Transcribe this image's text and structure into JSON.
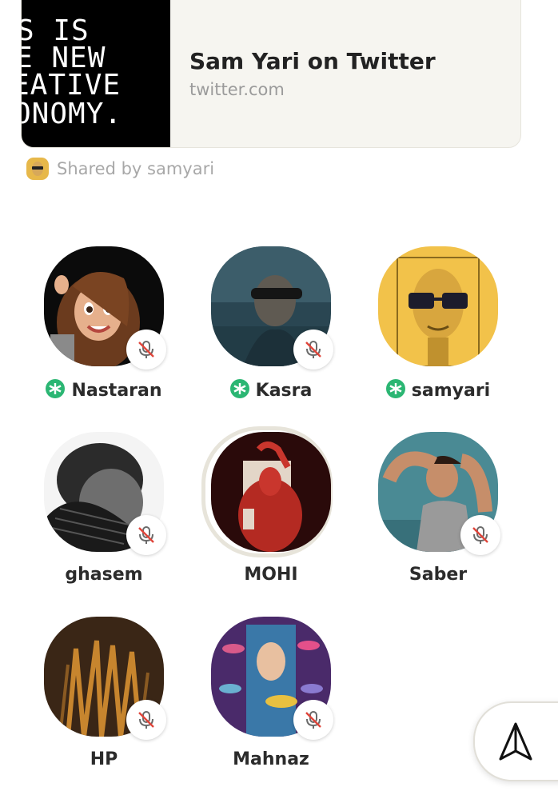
{
  "link_card": {
    "thumbnail_lines": [
      "S IS",
      "E NEW",
      "EATIVE",
      "ONOMY."
    ],
    "title": "Sam Yari on Twitter",
    "domain": "twitter.com"
  },
  "shared_by": "Shared by samyari",
  "speakers": [
    {
      "name": "Nastaran",
      "moderator": true,
      "muted": true
    },
    {
      "name": "Kasra",
      "moderator": true,
      "muted": true
    },
    {
      "name": "samyari",
      "moderator": true,
      "muted": false
    },
    {
      "name": "ghasem",
      "moderator": false,
      "muted": true
    },
    {
      "name": "MOHI",
      "moderator": false,
      "muted": false,
      "speaking": true
    },
    {
      "name": "Saber",
      "moderator": false,
      "muted": true
    },
    {
      "name": "HP",
      "moderator": false,
      "muted": true
    },
    {
      "name": "Mahnaz",
      "moderator": false,
      "muted": true
    }
  ],
  "colors": {
    "moderator_badge": "#2bb673",
    "mute_slash": "#e0453a",
    "background": "#ffffff"
  },
  "icons": {
    "mute": "mic-muted-icon",
    "moderator": "moderator-star-icon",
    "send": "paper-plane-icon"
  }
}
